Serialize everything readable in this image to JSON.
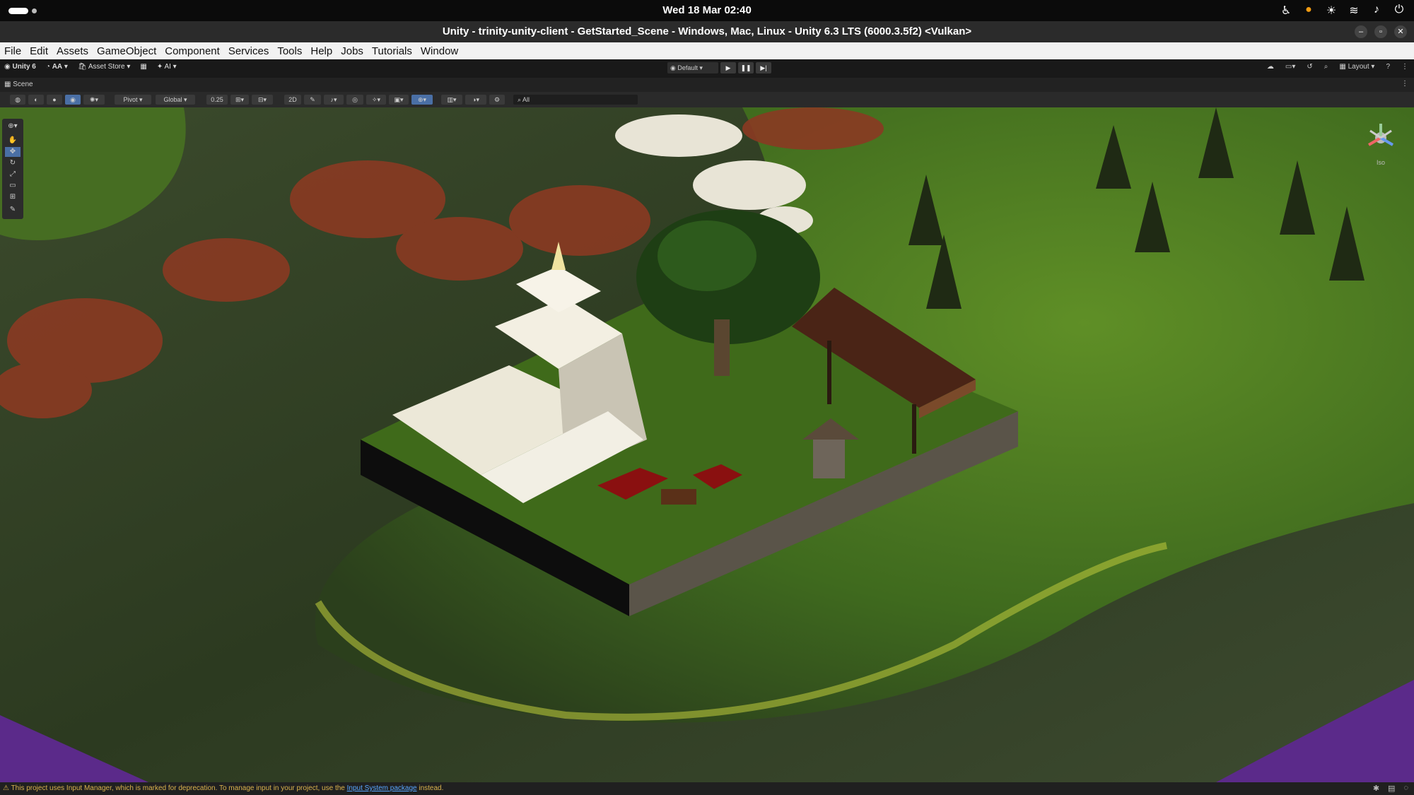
{
  "os": {
    "clock": "Wed 18 Mar  02:40",
    "tray_icons": [
      "accessibility-icon",
      "microphone-icon",
      "brightness-icon",
      "wifi-icon",
      "volume-icon",
      "power-icon"
    ]
  },
  "window": {
    "title": "Unity - trinity-unity-client - GetStarted_Scene - Windows, Mac, Linux - Unity 6.3 LTS (6000.3.5f2) <Vulkan>"
  },
  "menu": [
    "File",
    "Edit",
    "Assets",
    "GameObject",
    "Component",
    "Services",
    "Tools",
    "Help",
    "Jobs",
    "Tutorials",
    "Window"
  ],
  "toolbar": {
    "unity_label": "Unity 6",
    "account_label": "AA",
    "asset_store_label": "Asset Store",
    "ai_label": "AI",
    "build_profile": "Default",
    "layout_label": "Layout"
  },
  "scene_tab": {
    "label": "Scene"
  },
  "scene_tools": {
    "pivot_label": "Pivot",
    "global_label": "Global",
    "snap_value": "0.25",
    "search_placeholder": "All"
  },
  "gizmo": {
    "label": "Iso"
  },
  "status": {
    "message_start": "This project uses Input Manager, which is marked for deprecation. To manage input in your project, use the ",
    "link_text": "Input System package",
    "message_end": " instead."
  },
  "colors": {
    "grass": "#4f7a22",
    "dark_ground": "#2f3d25",
    "accent_purple": "#5b2a8a",
    "warning": "#d9b24d"
  }
}
